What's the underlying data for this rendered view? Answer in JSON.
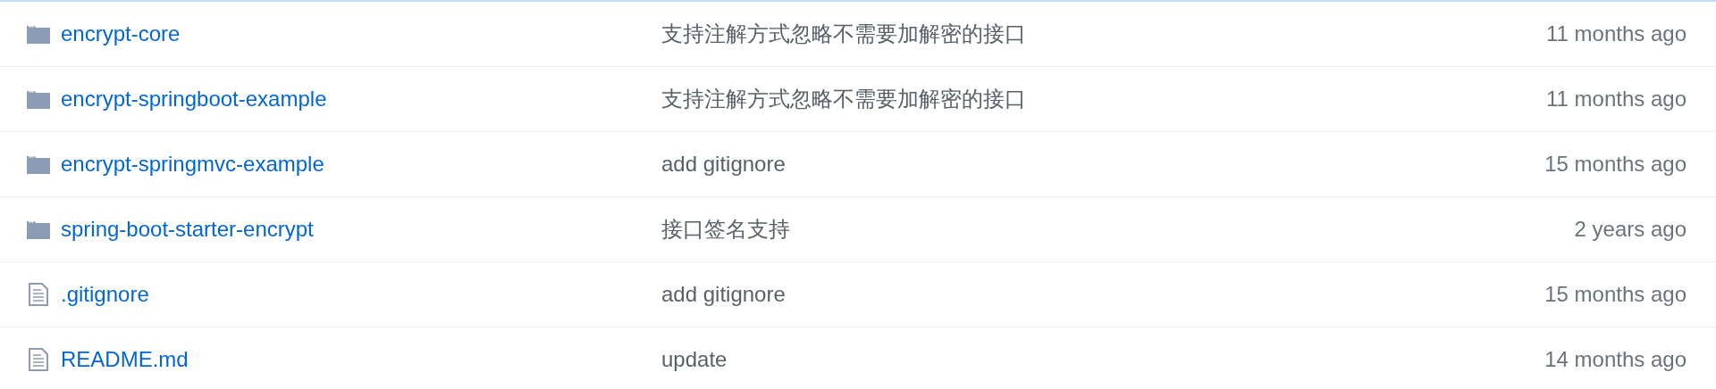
{
  "files": [
    {
      "kind": "directory",
      "name": "encrypt-core",
      "message": "支持注解方式忽略不需要加解密的接口",
      "age": "11 months ago"
    },
    {
      "kind": "directory",
      "name": "encrypt-springboot-example",
      "message": "支持注解方式忽略不需要加解密的接口",
      "age": "11 months ago"
    },
    {
      "kind": "directory",
      "name": "encrypt-springmvc-example",
      "message": "add gitignore",
      "age": "15 months ago"
    },
    {
      "kind": "directory",
      "name": "spring-boot-starter-encrypt",
      "message": "接口签名支持",
      "age": "2 years ago"
    },
    {
      "kind": "file",
      "name": ".gitignore",
      "message": "add gitignore",
      "age": "15 months ago"
    },
    {
      "kind": "file",
      "name": "README.md",
      "message": "update",
      "age": "14 months ago"
    }
  ]
}
